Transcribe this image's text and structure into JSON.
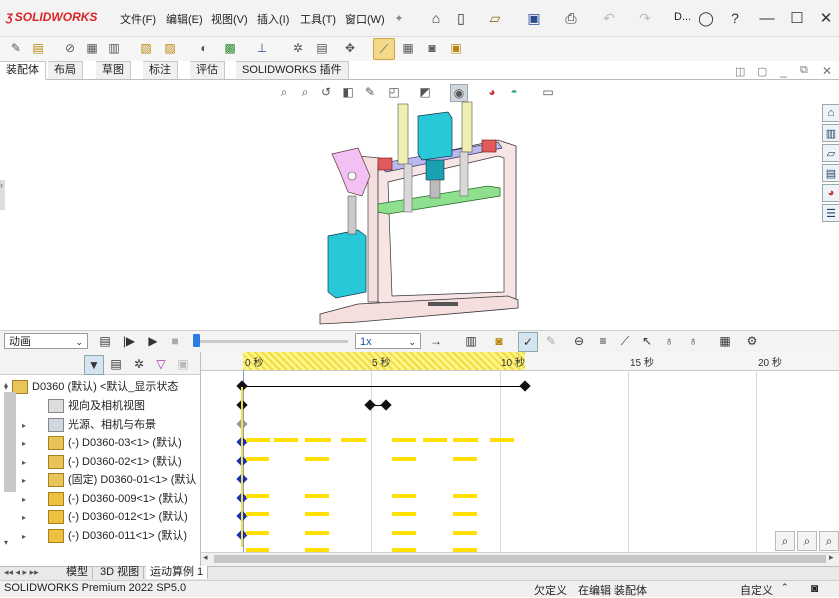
{
  "app": {
    "brand": "SOLIDWORKS",
    "doc_short": "D..."
  },
  "menu": [
    "文件(F)",
    "编辑(E)",
    "视图(V)",
    "插入(I)",
    "工具(T)",
    "窗口(W)"
  ],
  "tabs": [
    "装配体",
    "布局",
    "草图",
    "标注",
    "评估",
    "SOLIDWORKS 插件"
  ],
  "motion": {
    "study_type": "动画",
    "speed": "1x",
    "timeline_ticks": [
      "0 秒",
      "5 秒",
      "10 秒",
      "15 秒",
      "20 秒"
    ]
  },
  "tree": {
    "rows": [
      {
        "label": "D0360 (默认) <默认_显示状态",
        "arrow": "▾"
      },
      {
        "label": "视向及相机视图",
        "arrow": ""
      },
      {
        "label": "光源、相机与布景",
        "arrow": "▸"
      },
      {
        "label": "(-) D0360-03<1> (默认)",
        "arrow": "▸"
      },
      {
        "label": "(-) D0360-02<1> (默认)",
        "arrow": "▸"
      },
      {
        "label": "(固定) D0360-01<1> (默认",
        "arrow": "▸"
      },
      {
        "label": "(-) D0360-009<1> (默认)",
        "arrow": "▸"
      },
      {
        "label": "(-) D0360-012<1> (默认)",
        "arrow": "▸"
      },
      {
        "label": "(-) D0360-011<1> (默认)",
        "arrow": "▸"
      }
    ]
  },
  "bottom_tabs": [
    "模型",
    "3D 视图",
    "运动算例 1"
  ],
  "status": {
    "version": "SOLIDWORKS Premium 2022 SP5.0",
    "defined": "欠定义",
    "editing": "在编辑 装配体",
    "custom": "自定义"
  },
  "colors": {
    "accent": "#d8232a",
    "key_blue": "#1f2fae",
    "timeline_yellow": "#ffe000",
    "highlight": "#fff48a"
  }
}
